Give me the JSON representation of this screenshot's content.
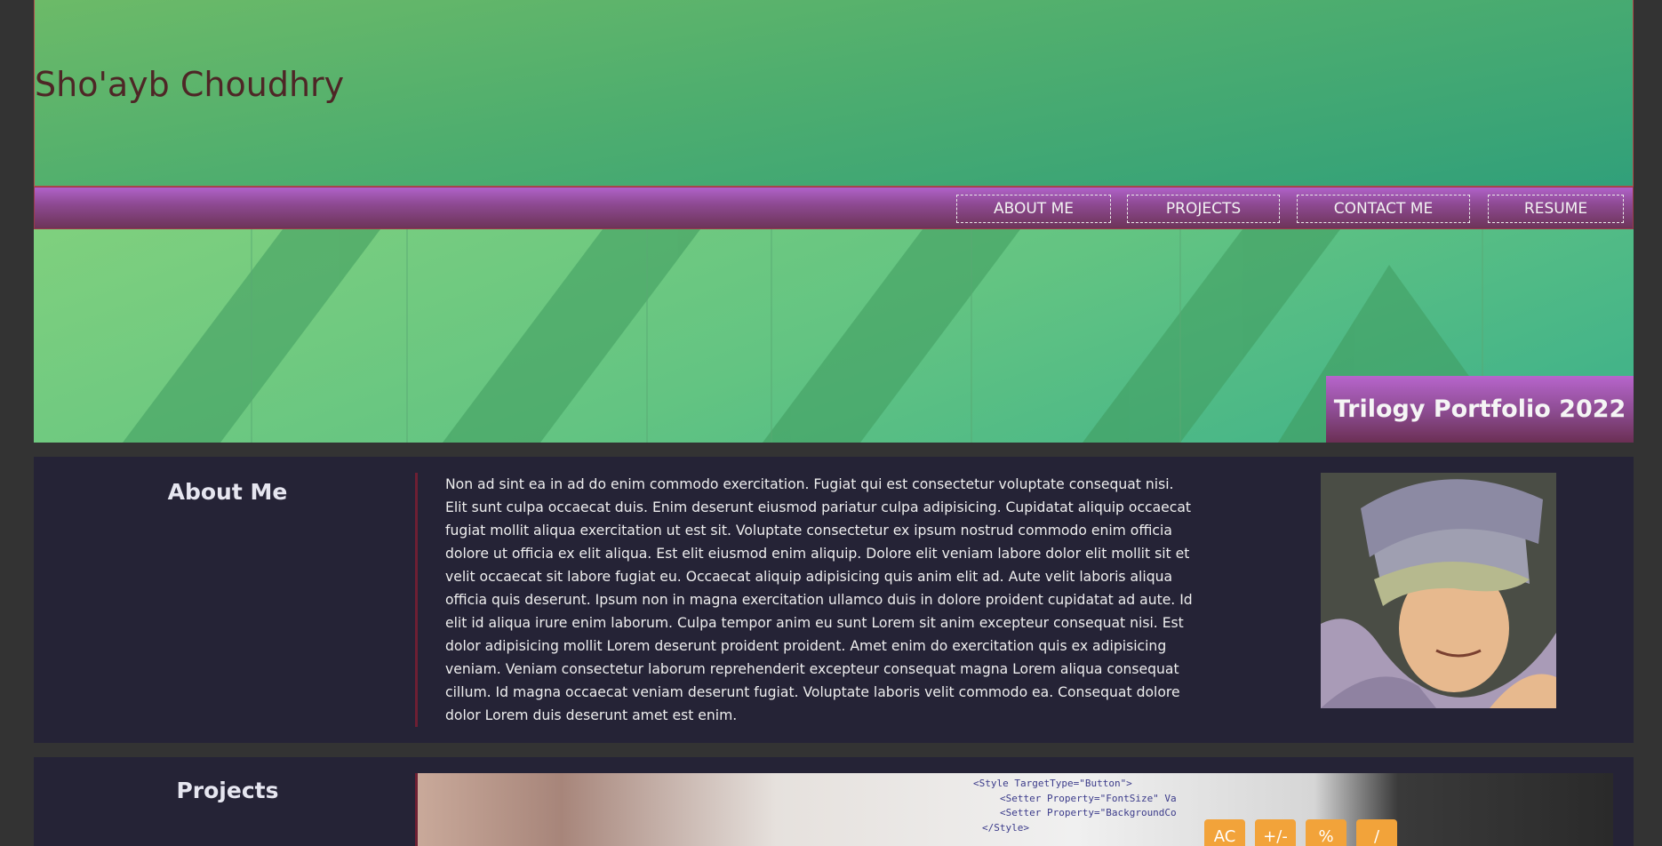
{
  "header": {
    "site_title": "Sho'ayb Choudhry"
  },
  "nav": {
    "items": [
      {
        "label": "ABOUT ME"
      },
      {
        "label": "PROJECTS"
      },
      {
        "label": "CONTACT ME"
      },
      {
        "label": "RESUME"
      }
    ]
  },
  "hero": {
    "badge": "Trilogy Portfolio 2022"
  },
  "about": {
    "title": "About Me",
    "body": "Non ad sint ea in ad do enim commodo exercitation. Fugiat qui est consectetur voluptate consequat nisi. Elit sunt culpa occaecat duis. Enim deserunt eiusmod pariatur culpa adipisicing. Cupidatat aliquip occaecat fugiat mollit aliqua exercitation ut est sit. Voluptate consectetur ex ipsum nostrud commodo enim officia dolore ut officia ex elit aliqua. Est elit eiusmod enim aliquip. Dolore elit veniam labore dolor elit mollit sit et velit occaecat sit labore fugiat eu. Occaecat aliquip adipisicing quis anim elit ad. Aute velit laboris aliqua officia quis deserunt. Ipsum non in magna exercitation ullamco duis in dolore proident cupidatat ad aute. Id elit id aliqua irure enim laborum. Culpa tempor anim eu sunt Lorem sit anim excepteur consequat nisi. Est dolor adipisicing mollit Lorem deserunt proident proident. Amet enim do exercitation quis ex adipisicing veniam. Veniam consectetur laborum reprehenderit excepteur consequat magna Lorem aliqua consequat cillum. Id magna occaecat veniam deserunt fugiat. Voluptate laboris velit commodo ea. Consequat dolore dolor Lorem duis deserunt amet est enim."
  },
  "projects": {
    "title": "Projects",
    "image_code_lines": [
      "<Style TargetType=\"Button\">",
      "<Setter Property=\"FontSize\" Va",
      "<Setter Property=\"BackgroundCo",
      "</Style>"
    ],
    "calc_keys": [
      "AC",
      "+/-",
      "%",
      "/"
    ]
  },
  "colors": {
    "page_bg": "#333333",
    "header_green": "#4fae6e",
    "nav_purple": "#8e4a93",
    "title_color": "#4e2626",
    "section_bg": "#252336",
    "accent_line": "#6e1f33"
  }
}
